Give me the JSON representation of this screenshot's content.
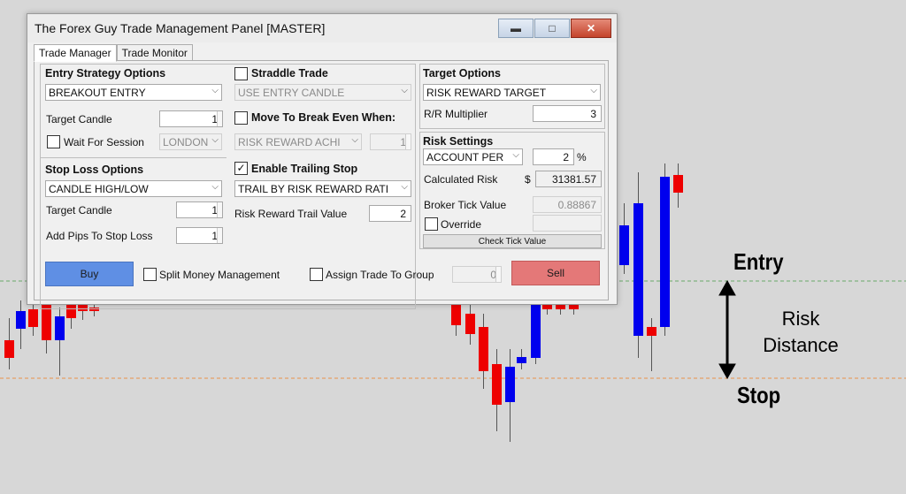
{
  "window": {
    "title": "The Forex Guy Trade Management Panel [MASTER]",
    "minimize_symbol": "▬",
    "maximize_symbol": "□",
    "close_symbol": "✕"
  },
  "tabs": [
    {
      "label": "Trade Manager",
      "active": true
    },
    {
      "label": "Trade Monitor",
      "active": false
    }
  ],
  "entry_strategy": {
    "heading": "Entry Strategy Options",
    "strategy_value": "BREAKOUT ENTRY",
    "target_candle_label": "Target Candle",
    "target_candle_value": "1",
    "wait_for_session_label": "Wait For Session",
    "wait_for_session_checked": false,
    "session_value": "LONDON"
  },
  "straddle": {
    "label": "Straddle Trade",
    "checked": false,
    "candle_value": "USE ENTRY CANDLE",
    "move_be_label": "Move To Break Even When:",
    "move_be_checked": false,
    "be_value": "RISK REWARD ACHI",
    "be_number": "1"
  },
  "stop_loss": {
    "heading": "Stop Loss Options",
    "stop_value": "CANDLE HIGH/LOW",
    "target_candle_label": "Target Candle",
    "target_candle_value": "1",
    "add_pips_label": "Add Pips To Stop Loss",
    "add_pips_value": "1"
  },
  "trailing": {
    "label": "Enable Trailing Stop",
    "checked": true,
    "check_glyph": "✓",
    "mode_value": "TRAIL BY RISK REWARD RATI",
    "trail_value_label": "Risk Reward Trail Value",
    "trail_value": "2"
  },
  "target_options": {
    "heading": "Target Options",
    "target_value": "RISK REWARD TARGET",
    "rr_label": "R/R Multiplier",
    "rr_value": "3"
  },
  "risk_settings": {
    "heading": "Risk Settings",
    "mode_value": "ACCOUNT PER",
    "percent_value": "2",
    "percent_symbol": "%",
    "calc_label": "Calculated Risk",
    "currency": "$",
    "calc_value": "31381.57",
    "tick_label": "Broker Tick Value",
    "tick_value": "0.88867",
    "override_label": "Override",
    "override_checked": false,
    "check_tick_label": "Check Tick Value"
  },
  "actions": {
    "buy_label": "Buy",
    "split_label": "Split Money Management",
    "split_checked": false,
    "group_label": "Assign Trade To Group",
    "group_checked": false,
    "group_value": "0",
    "sell_label": "Sell"
  },
  "annotations": {
    "entry": "Entry",
    "risk_line1": "Risk",
    "risk_line2": "Distance",
    "stop": "Stop"
  },
  "colors": {
    "bull_candle": "#0000ee",
    "bear_candle": "#ee0000",
    "arrow": "#f5a623",
    "entry_line": "#6aa86a",
    "stop_line": "#e8904a",
    "buy": "#5f8fe4",
    "sell": "#e47878"
  },
  "chart_data": {
    "type": "candlestick",
    "candles": [
      {
        "o": 385,
        "c": 405,
        "h": 360,
        "l": 418
      },
      {
        "o": 372,
        "c": 352,
        "h": 340,
        "l": 395
      },
      {
        "o": 350,
        "c": 370,
        "h": 335,
        "l": 380
      },
      {
        "o": 340,
        "c": 385,
        "h": 330,
        "l": 400
      },
      {
        "o": 385,
        "c": 358,
        "h": 348,
        "l": 425
      },
      {
        "o": 345,
        "c": 360,
        "h": 335,
        "l": 372
      },
      {
        "o": 345,
        "c": 352,
        "h": 340,
        "l": 362
      },
      {
        "o": 348,
        "c": 352,
        "h": 343,
        "l": 358
      },
      {
        "o": 345,
        "c": 368,
        "h": 335,
        "l": 380
      },
      {
        "o": 355,
        "c": 378,
        "h": 345,
        "l": 390
      },
      {
        "o": 370,
        "c": 420,
        "h": 355,
        "l": 440
      },
      {
        "o": 412,
        "c": 458,
        "h": 395,
        "l": 488
      },
      {
        "o": 455,
        "c": 415,
        "h": 395,
        "l": 500
      },
      {
        "o": 411,
        "c": 404,
        "h": 395,
        "l": 418
      },
      {
        "o": 405,
        "c": 320,
        "h": 310,
        "l": 412
      },
      {
        "o": 345,
        "c": 350,
        "h": 340,
        "l": 356
      },
      {
        "o": 344,
        "c": 350,
        "h": 338,
        "l": 356
      },
      {
        "o": 345,
        "c": 350,
        "h": 340,
        "l": 356
      },
      {
        "o": 275,
        "c": 300,
        "h": 265,
        "l": 310
      },
      {
        "o": 300,
        "c": 255,
        "h": 230,
        "l": 310
      },
      {
        "o": 380,
        "c": 230,
        "h": 195,
        "l": 405
      },
      {
        "o": 370,
        "c": 380,
        "h": 360,
        "l": 420
      },
      {
        "o": 370,
        "c": 200,
        "h": 185,
        "l": 380
      },
      {
        "o": 198,
        "c": 218,
        "h": 185,
        "l": 235
      }
    ]
  }
}
